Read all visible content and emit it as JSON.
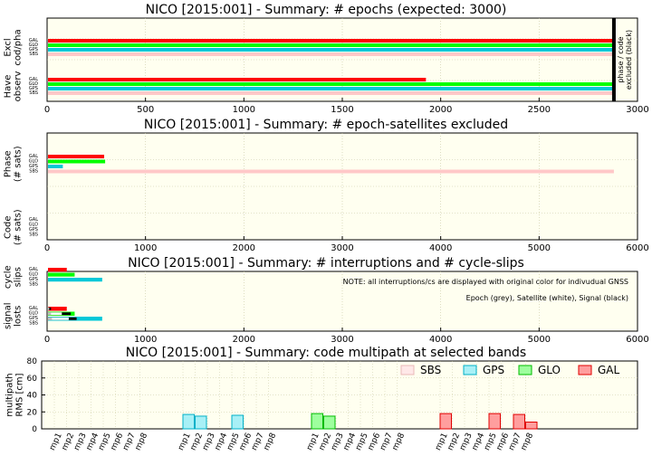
{
  "chart_data": [
    {
      "type": "bar",
      "title": "NICO [2015:001] - Summary: # epochs (expected: 3000)",
      "orientation": "horizontal",
      "xlim": [
        0,
        3000
      ],
      "xticks": [
        "0",
        "500",
        "1000",
        "1500",
        "2000",
        "2500",
        "3000"
      ],
      "grid": true,
      "groups": [
        {
          "label": "Excl\ncod/pha",
          "rows": [
            {
              "system": "GAL",
              "value": 2880
            },
            {
              "system": "GLO",
              "value": 2880
            },
            {
              "system": "GPS",
              "value": 2880
            },
            {
              "system": "SBS",
              "value": 2880
            }
          ]
        },
        {
          "label": "Have\nobserv",
          "rows": [
            {
              "system": "GAL",
              "value": 1925
            },
            {
              "system": "GLO",
              "value": 2880
            },
            {
              "system": "GPS",
              "value": 2880
            },
            {
              "system": "SBS",
              "value": 2880
            }
          ]
        }
      ],
      "marker": {
        "value": 2880,
        "label": "phase / code\nexcluded (black)"
      }
    },
    {
      "type": "bar",
      "title": "NICO [2015:001] - Summary: # epoch-satellites excluded",
      "orientation": "horizontal",
      "xlim": [
        0,
        6000
      ],
      "xticks": [
        "0",
        "1000",
        "2000",
        "3000",
        "4000",
        "5000",
        "6000"
      ],
      "grid": true,
      "groups": [
        {
          "label": "Phase\n(# sats)",
          "rows": [
            {
              "system": "GAL",
              "value": 580
            },
            {
              "system": "GLO",
              "value": 590
            },
            {
              "system": "GPS",
              "value": 160
            },
            {
              "system": "SBS",
              "value": 5760
            }
          ]
        },
        {
          "label": "Code\n(# sats)",
          "rows": [
            {
              "system": "GAL",
              "value": 0
            },
            {
              "system": "GLO",
              "value": 0
            },
            {
              "system": "GPS",
              "value": 0
            },
            {
              "system": "SBS",
              "value": 0
            }
          ]
        }
      ]
    },
    {
      "type": "bar",
      "title": "NICO [2015:001] - Summary: # interruptions and # cycle-slips",
      "orientation": "horizontal",
      "xlim": [
        0,
        6000
      ],
      "xticks": [
        "0",
        "1000",
        "2000",
        "3000",
        "4000",
        "5000",
        "6000"
      ],
      "grid": true,
      "annotations": [
        "NOTE: all interruptions/cs are displayed with original color for indivudual GNSS",
        "Epoch (grey), Satellite (white), Signal (black)"
      ],
      "groups": [
        {
          "label": "cycle\nslips",
          "rows": [
            {
              "system": "GAL",
              "value": 200
            },
            {
              "system": "GLO",
              "value": 280
            },
            {
              "system": "GPS",
              "value": 560
            },
            {
              "system": "SBS",
              "value": 0
            }
          ]
        },
        {
          "label": "signal\nlosts",
          "rows": [
            {
              "system": "GAL",
              "value": 200,
              "epoch": 20,
              "satellite": 20,
              "signal": 40
            },
            {
              "system": "GLO",
              "value": 280,
              "epoch": 40,
              "satellite": 150,
              "signal": 240
            },
            {
              "system": "GPS",
              "value": 560,
              "epoch": 50,
              "satellite": 220,
              "signal": 300
            },
            {
              "system": "SBS",
              "value": 0
            }
          ]
        }
      ]
    },
    {
      "type": "bar",
      "title": "NICO [2015:001] - Summary: code multipath at selected bands",
      "ylabel": "multipath\nRMS [cm]",
      "ylim": [
        0,
        80
      ],
      "yticks": [
        "0",
        "20",
        "40",
        "60",
        "80"
      ],
      "grid": true,
      "legend_position": "top-right",
      "categories": [
        "mp1",
        "mp2",
        "mp3",
        "mp4",
        "mp5",
        "mp6",
        "mp7",
        "mp8"
      ],
      "series": [
        {
          "name": "SBS",
          "values": [
            0,
            0,
            0,
            0,
            0,
            0,
            0,
            0
          ]
        },
        {
          "name": "GPS",
          "values": [
            17,
            15,
            0,
            0,
            16,
            0,
            0,
            0
          ]
        },
        {
          "name": "GLO",
          "values": [
            18,
            15,
            0,
            0,
            0,
            0,
            0,
            0
          ]
        },
        {
          "name": "GAL",
          "values": [
            18,
            0,
            0,
            0,
            18,
            0,
            17,
            8
          ]
        }
      ]
    }
  ],
  "systems": [
    "GAL",
    "GLO",
    "GPS",
    "SBS"
  ],
  "colors": {
    "GAL": {
      "fill": "#ff0000",
      "light": "#ff9e9e",
      "line": "#e00000"
    },
    "GLO": {
      "fill": "#00ff00",
      "light": "#9eff9e",
      "line": "#00bb00"
    },
    "GPS": {
      "fill": "#00c8d8",
      "light": "#a8f0f6",
      "line": "#00b0c8"
    },
    "SBS": {
      "fill": "#ffc8c8",
      "light": "#ffe8e8",
      "line": "#e8b8b8"
    },
    "background": "#fffff0",
    "grid": "#c8c8a0",
    "epoch": "#c0c0c0",
    "satellite": "#ffffff",
    "signal": "#000000"
  }
}
